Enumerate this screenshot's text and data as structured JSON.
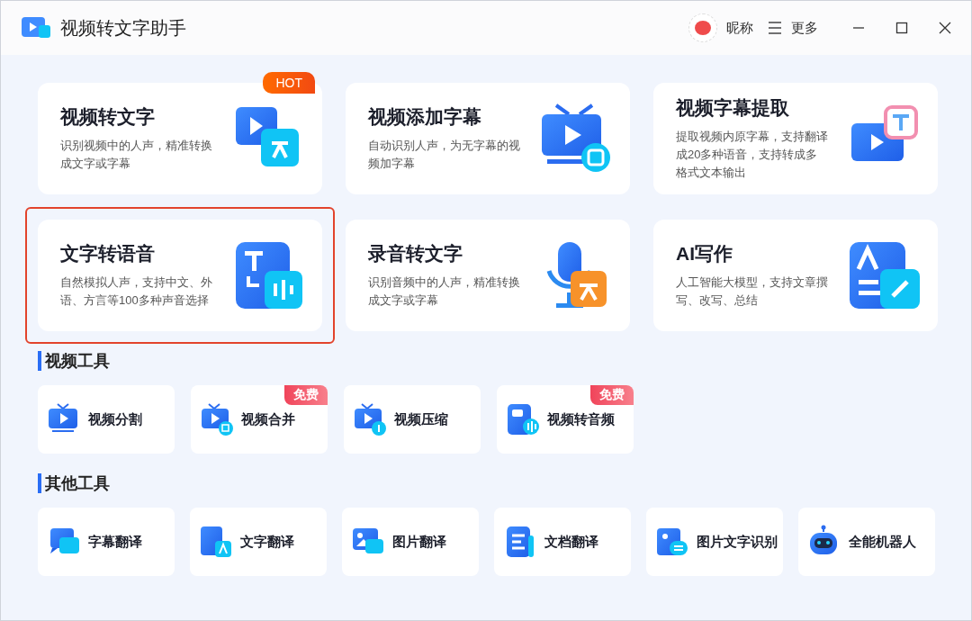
{
  "window": {
    "title": "视频转文字助手",
    "user": "昵称",
    "more": "更多"
  },
  "features": [
    {
      "title": "视频转文字",
      "description_lines": [
        "识别视频中的人声，精准转换",
        "成文字或字幕"
      ],
      "badge": "HOT",
      "selected": false
    },
    {
      "title": "视频添加字幕",
      "description_lines": [
        "自动识别人声，为无字幕的视",
        "频加字幕"
      ],
      "selected": false
    },
    {
      "title": "视频字幕提取",
      "description_lines": [
        "提取视频内原字幕，支持翻译",
        "成20多种语音，支持转成多",
        "格式文本输出"
      ],
      "selected": false
    },
    {
      "title": "文字转语音",
      "description_lines": [
        "自然模拟人声，支持中文、外",
        "语、方言等100多种声音选择"
      ],
      "selected": true
    },
    {
      "title": "录音转文字",
      "description_lines": [
        "识别音频中的人声，精准转换",
        "成文字或字幕"
      ],
      "selected": false
    },
    {
      "title": "AI写作",
      "description_lines": [
        "人工智能大模型，支持文章撰",
        "写、改写、总结"
      ],
      "selected": false
    }
  ],
  "sections": [
    {
      "title": "视频工具",
      "tools": [
        {
          "label": "视频分割"
        },
        {
          "label": "视频合并",
          "badge": "免费"
        },
        {
          "label": "视频压缩"
        },
        {
          "label": "视频转音频",
          "badge": "免费"
        }
      ]
    },
    {
      "title": "其他工具",
      "tools": [
        {
          "label": "字幕翻译"
        },
        {
          "label": "文字翻译"
        },
        {
          "label": "图片翻译"
        },
        {
          "label": "文档翻译"
        },
        {
          "label": "图片文字识别"
        },
        {
          "label": "全能机器人"
        }
      ]
    }
  ]
}
